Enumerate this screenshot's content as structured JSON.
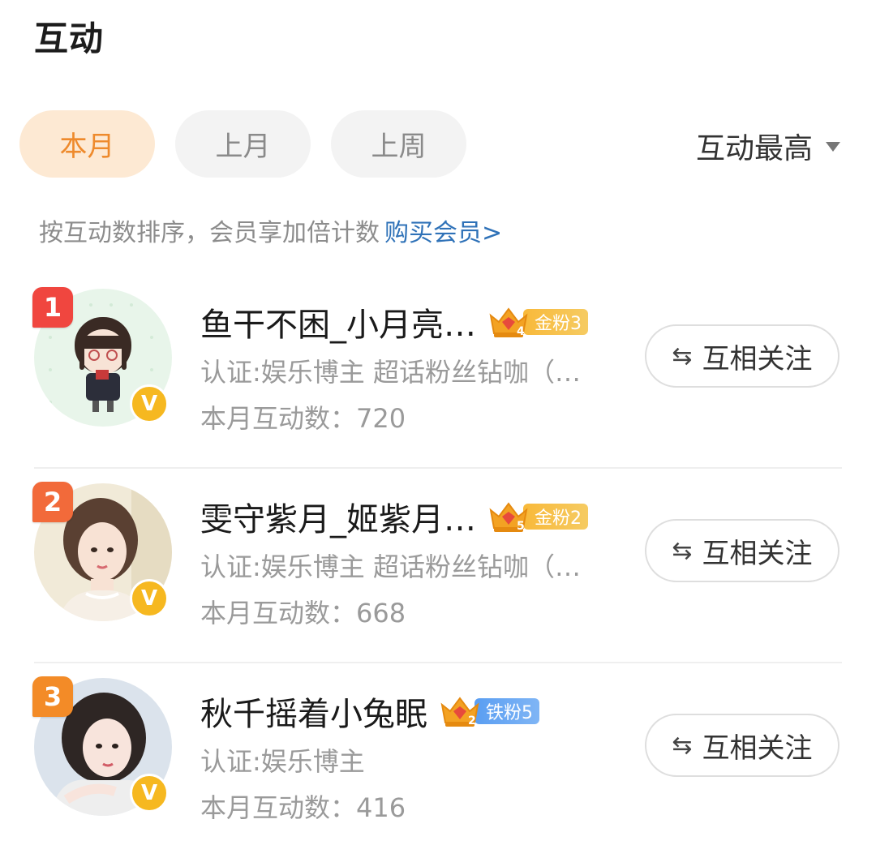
{
  "page": {
    "title": "互动"
  },
  "tabs": [
    {
      "label": "本月",
      "active": true
    },
    {
      "label": "上月",
      "active": false
    },
    {
      "label": "上周",
      "active": false
    }
  ],
  "sort": {
    "label": "互动最高",
    "icon": "caret-down-icon"
  },
  "hint": {
    "text": "按互动数排序，会员享加倍计数",
    "link": "购买会员>"
  },
  "follow_label": "互相关注",
  "follow_icon": "⇆",
  "verified_icon": "V",
  "users": [
    {
      "rank": "1",
      "name": "鱼干不困_小月亮…",
      "medal": {
        "type": "gold",
        "level_digit": "4",
        "label": "金粉3"
      },
      "sub": "认证:娱乐博主 超话粉丝钻咖（…",
      "count_label": "本月互动数：",
      "count": "720"
    },
    {
      "rank": "2",
      "name": "雯守紫月_姬紫月…",
      "medal": {
        "type": "gold",
        "level_digit": "5",
        "label": "金粉2"
      },
      "sub": "认证:娱乐博主 超话粉丝钻咖（…",
      "count_label": "本月互动数：",
      "count": "668"
    },
    {
      "rank": "3",
      "name": "秋千摇着小兔眠",
      "medal": {
        "type": "iron",
        "level_digit": "2",
        "label": "铁粉5"
      },
      "sub": "认证:娱乐博主",
      "count_label": "本月互动数：",
      "count": "416"
    }
  ],
  "colors": {
    "accent": "#ee8a2c",
    "link": "#2f72b8",
    "rank1": "#f0463f",
    "rank2": "#f26a3a",
    "rank3": "#f38b27"
  }
}
